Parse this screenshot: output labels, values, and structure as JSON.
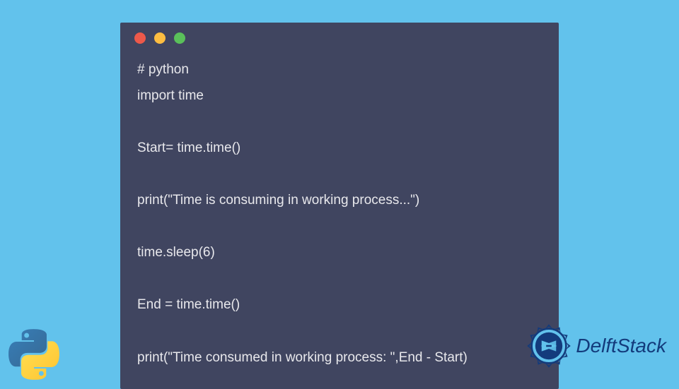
{
  "code": {
    "lines": "# python\nimport time\n\nStart= time.time()\n\nprint(\"Time is consuming in working process...\")\n\ntime.sleep(6)\n\nEnd = time.time()\n\nprint(\"Time consumed in working process: \",End - Start)"
  },
  "brand": {
    "name": "DelftStack"
  }
}
